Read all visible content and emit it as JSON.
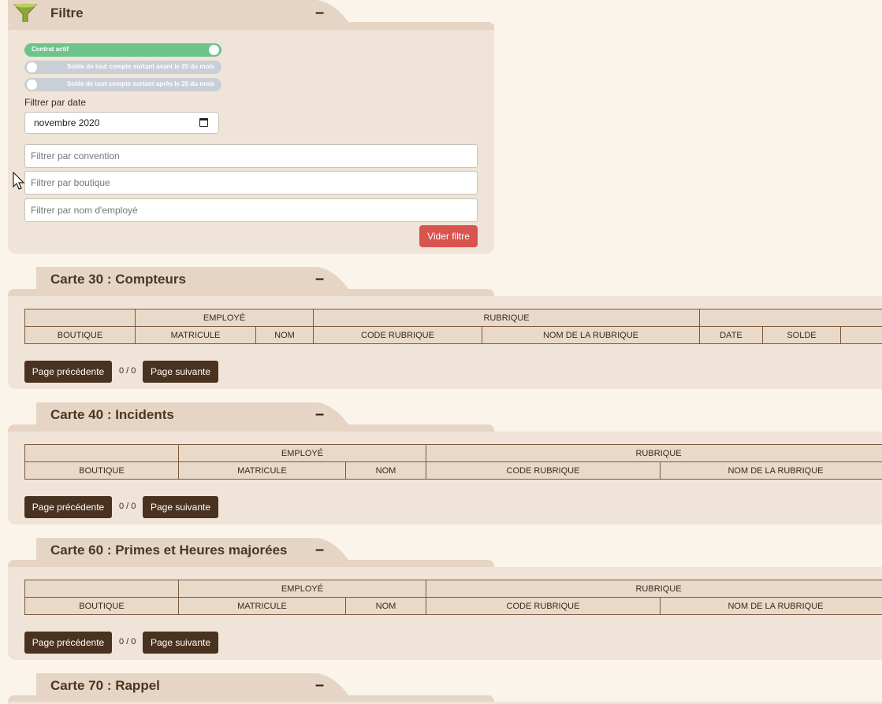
{
  "filter": {
    "title": "Filtre",
    "collapse": "–",
    "toggles": [
      {
        "label": "Contrat actif",
        "on": true
      },
      {
        "label": "Solde de tout compte sortant avant le 20 du mois",
        "on": false
      },
      {
        "label": "Solde de tout compte sortant après le 20 du mois",
        "on": false
      }
    ],
    "date_label": "Filtrer par date",
    "date_value": "novembre 2020",
    "convention_placeholder": "Filtrer par convention",
    "boutique_placeholder": "Filtrer par boutique",
    "employe_placeholder": "Filtrer par nom d'employé",
    "clear_label": "Vider filtre"
  },
  "cards": [
    {
      "title": "Carte 30 : Compteurs",
      "group_employe": "EMPLOYÉ",
      "group_rubrique": "RUBRIQUE",
      "col_boutique": "BOUTIQUE",
      "col_matricule": "MATRICULE",
      "col_nom": "NOM",
      "col_code": "CODE RUBRIQUE",
      "col_nom_rubrique": "NOM DE LA RUBRIQUE",
      "col_date": "DATE",
      "col_solde": "SOLDE"
    },
    {
      "title": "Carte 40 : Incidents",
      "group_employe": "EMPLOYÉ",
      "group_rubrique": "RUBRIQUE",
      "col_boutique": "BOUTIQUE",
      "col_matricule": "MATRICULE",
      "col_nom": "NOM",
      "col_code": "CODE RUBRIQUE",
      "col_nom_rubrique": "NOM DE LA RUBRIQUE"
    },
    {
      "title": "Carte 60 : Primes et Heures majorées",
      "group_employe": "EMPLOYÉ",
      "group_rubrique": "RUBRIQUE",
      "col_boutique": "BOUTIQUE",
      "col_matricule": "MATRICULE",
      "col_nom": "NOM",
      "col_code": "CODE RUBRIQUE",
      "col_nom_rubrique": "NOM DE LA RUBRIQUE"
    },
    {
      "title": "Carte 70 : Rappel"
    }
  ],
  "pager": {
    "prev_label": "Page précédente",
    "next_label": "Page suivante",
    "status": "0 / 0"
  },
  "colors": {
    "accent_red": "#d9534f",
    "brown": "#4a3220",
    "toggle_on": "#6cc48a"
  }
}
